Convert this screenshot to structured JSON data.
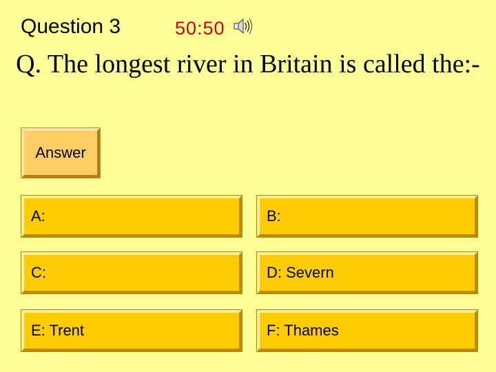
{
  "header": {
    "question_number": "Question 3",
    "lifeline": "50:50",
    "sound_icon": "speaker-icon"
  },
  "question": {
    "text": "Q. The longest river in Britain is called the:-"
  },
  "answer_button": {
    "label": "Answer"
  },
  "options": [
    {
      "label": "A:"
    },
    {
      "label": "B:"
    },
    {
      "label": "C:"
    },
    {
      "label": "D: Severn"
    },
    {
      "label": "E: Trent"
    },
    {
      "label": "F: Thames"
    }
  ],
  "colors": {
    "background": "#ffff99",
    "option_fill": "#ffcc00",
    "answer_fill": "#ffcc66",
    "lifeline_text": "#cc0000"
  }
}
